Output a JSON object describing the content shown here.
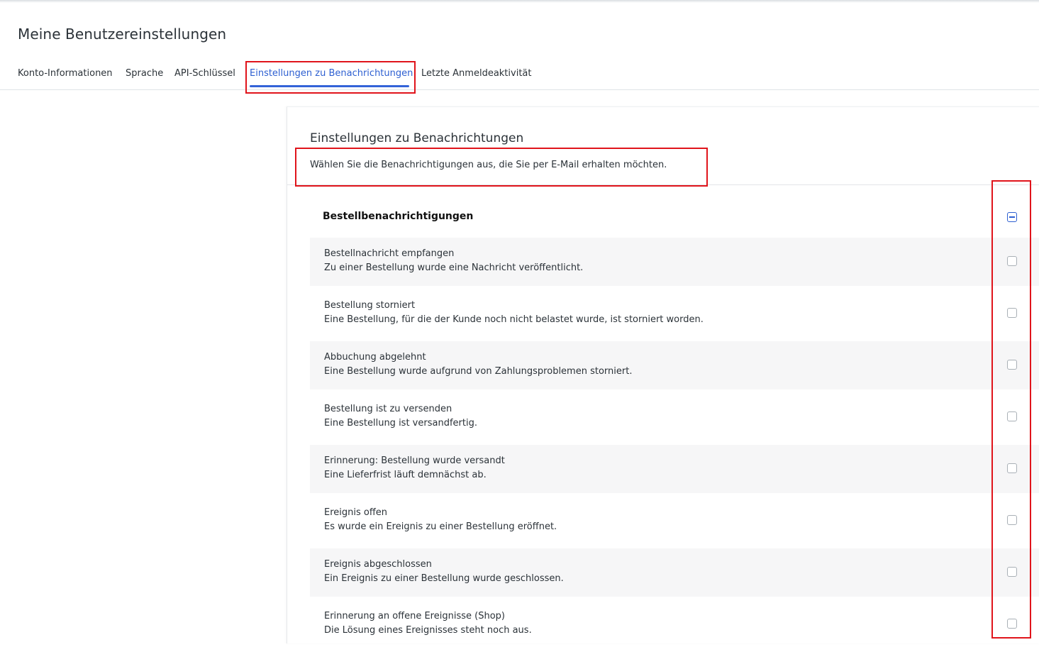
{
  "page": {
    "title": "Meine Benutzereinstellungen"
  },
  "tabs": [
    {
      "label": "Konto-Informationen"
    },
    {
      "label": "Sprache"
    },
    {
      "label": "API-Schlüssel"
    },
    {
      "label": "Einstellungen zu Benachrichtungen",
      "active": true
    },
    {
      "label": "Letzte Anmeldeaktivität"
    }
  ],
  "panel": {
    "title": "Einstellungen zu Benachrichtungen",
    "description": "Wählen Sie die Benachrichtigungen aus, die Sie per E-Mail erhalten möchten.",
    "group": {
      "title": "Bestellbenachrichtigungen",
      "checkbox_state": "indeterminate",
      "items": [
        {
          "title": "Bestellnachricht empfangen",
          "description": "Zu einer Bestellung wurde eine Nachricht veröffentlicht.",
          "checked": false
        },
        {
          "title": "Bestellung storniert",
          "description": "Eine Bestellung, für die der Kunde noch nicht belastet wurde, ist storniert worden.",
          "checked": false
        },
        {
          "title": "Abbuchung abgelehnt",
          "description": "Eine Bestellung wurde aufgrund von Zahlungsproblemen storniert.",
          "checked": false
        },
        {
          "title": "Bestellung ist zu versenden",
          "description": "Eine Bestellung ist versandfertig.",
          "checked": false
        },
        {
          "title": "Erinnerung: Bestellung wurde versandt",
          "description": "Eine Lieferfrist läuft demnächst ab.",
          "checked": false
        },
        {
          "title": "Ereignis offen",
          "description": "Es wurde ein Ereignis zu einer Bestellung eröffnet.",
          "checked": false
        },
        {
          "title": "Ereignis abgeschlossen",
          "description": "Ein Ereignis zu einer Bestellung wurde geschlossen.",
          "checked": false
        },
        {
          "title": "Erinnerung an offene Ereignisse (Shop)",
          "description": "Die Lösung eines Ereignisses steht noch aus.",
          "checked": false
        }
      ]
    }
  },
  "colors": {
    "accent": "#2d5fd1",
    "highlight": "#e0141b",
    "row_shade": "#f6f6f7"
  }
}
